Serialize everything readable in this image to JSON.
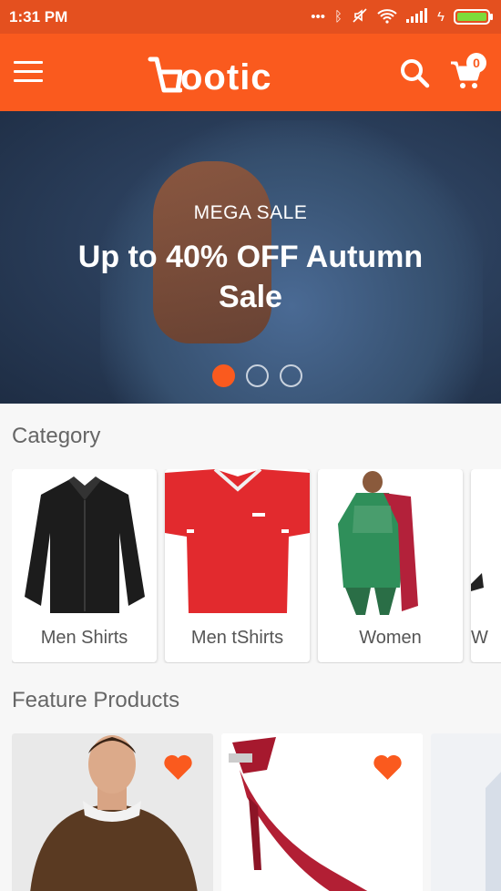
{
  "status_bar": {
    "time": "1:31 PM",
    "icons": [
      "more-dots-icon",
      "bluetooth-icon",
      "mute-icon",
      "wifi-icon",
      "signal-icon",
      "charging-icon",
      "battery-icon"
    ]
  },
  "app_bar": {
    "logo_text": "ootic",
    "cart_count": "0",
    "accent_color": "#fa5a1e"
  },
  "banner": {
    "subtitle": "MEGA SALE",
    "title": "Up to 40% OFF Autumn Sale",
    "slides": 3,
    "active_slide": 1
  },
  "category": {
    "heading": "Category",
    "items": [
      {
        "label": "Men Shirts",
        "image": "black-shirt"
      },
      {
        "label": "Men tShirts",
        "image": "red-polo"
      },
      {
        "label": "Women",
        "image": "green-dress"
      },
      {
        "label": "W",
        "image": "partial"
      }
    ]
  },
  "featured": {
    "heading": "Feature Products",
    "items": [
      {
        "image": "man-sweater",
        "favorite": true
      },
      {
        "image": "red-heel",
        "favorite": true
      },
      {
        "image": "partial",
        "favorite": false
      }
    ]
  }
}
